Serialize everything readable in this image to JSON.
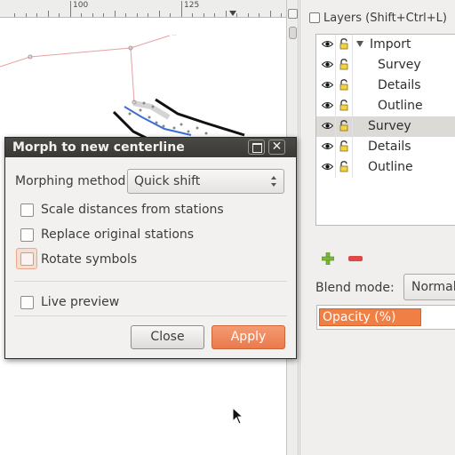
{
  "canvas": {
    "ruler_labels": [
      "100",
      "125"
    ]
  },
  "layers_panel": {
    "title": "Layers (Shift+Ctrl+L)",
    "rows": [
      {
        "name": "Import",
        "expander": true,
        "selected": false
      },
      {
        "name": "Survey",
        "expander": false,
        "selected": false
      },
      {
        "name": "Details",
        "expander": false,
        "selected": false
      },
      {
        "name": "Outline",
        "expander": false,
        "selected": false
      },
      {
        "name": "Survey",
        "expander": false,
        "selected": true
      },
      {
        "name": "Details",
        "expander": false,
        "selected": false
      },
      {
        "name": "Outline",
        "expander": false,
        "selected": false
      }
    ],
    "add_icon": "plus-icon",
    "remove_icon": "minus-icon",
    "blend_mode_label": "Blend mode:",
    "blend_mode_value": "Normal",
    "opacity_label": "Opacity (%)",
    "opacity_fraction": 0.74,
    "accent_color": "#f07f46"
  },
  "dialog": {
    "title": "Morph to new centerline",
    "maximize_icon": "maximize-icon",
    "close_icon": "close-icon",
    "close_glyph": "✕",
    "morphing_method_label": "Morphing method",
    "morphing_method_value": "Quick shift",
    "options": [
      {
        "label": "Scale distances from stations",
        "checked": false
      },
      {
        "label": "Replace original stations",
        "checked": false
      },
      {
        "label": "Rotate symbols",
        "checked": false
      }
    ],
    "live_preview_label": "Live preview",
    "live_preview_checked": false,
    "close_label": "Close",
    "apply_label": "Apply"
  }
}
